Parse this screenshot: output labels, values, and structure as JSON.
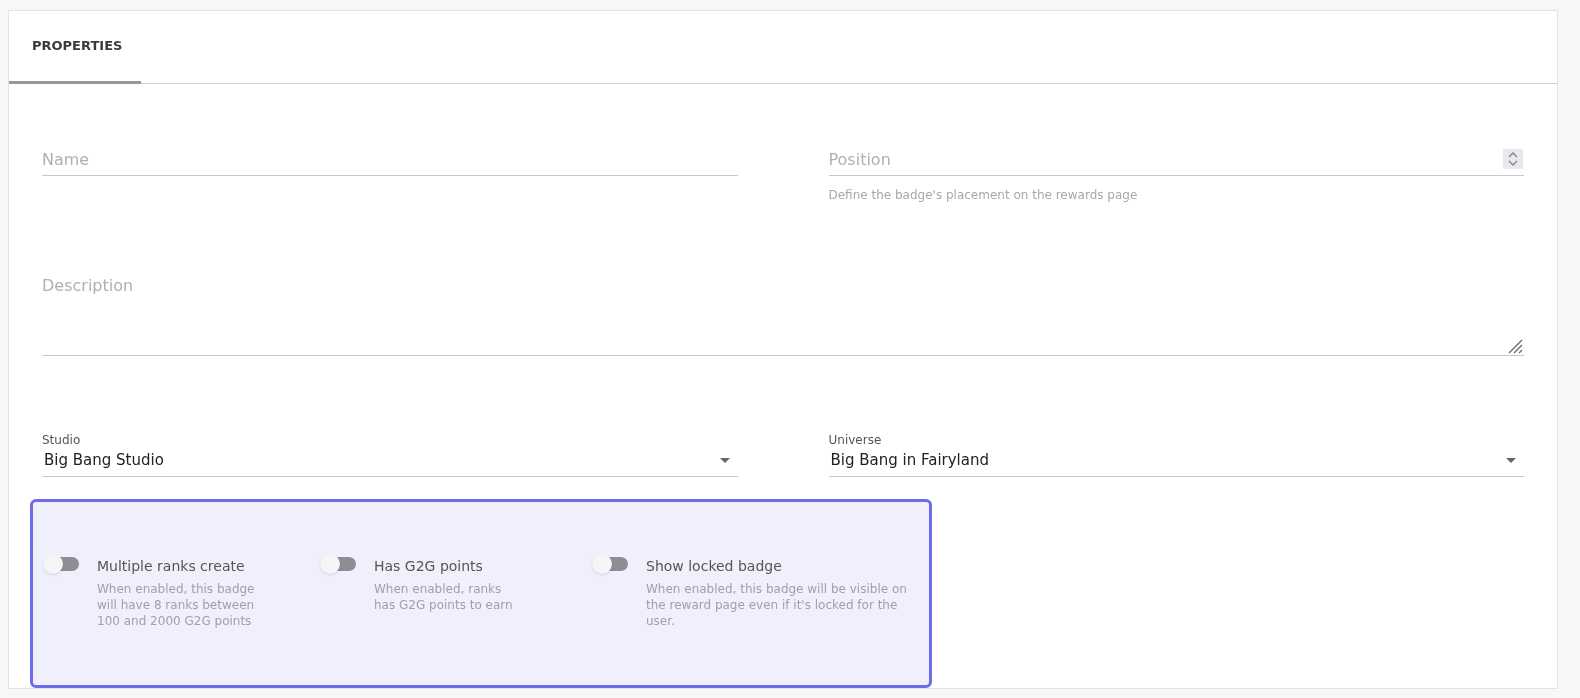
{
  "tabs": [
    {
      "label": "PROPERTIES",
      "selected": true
    }
  ],
  "name_field": {
    "placeholder": "Name"
  },
  "position_field": {
    "placeholder": "Position",
    "helper": "Define the badge's placement on the rewards page"
  },
  "description_field": {
    "placeholder": "Description"
  },
  "studio_select": {
    "label": "Studio",
    "value": "Big Bang Studio"
  },
  "universe_select": {
    "label": "Universe",
    "value": "Big Bang in Fairyland"
  },
  "toggles": [
    {
      "label": "Multiple ranks create",
      "description": "When enabled, this badge will have 8 ranks between 100 and 2000 G2G points",
      "on": false
    },
    {
      "label": "Has G2G points",
      "description": "When enabled, ranks has G2G points to earn",
      "on": false
    },
    {
      "label": "Show locked badge",
      "description": "When enabled, this badge will be visible on the reward page even if it's locked for the user.",
      "on": false
    }
  ]
}
